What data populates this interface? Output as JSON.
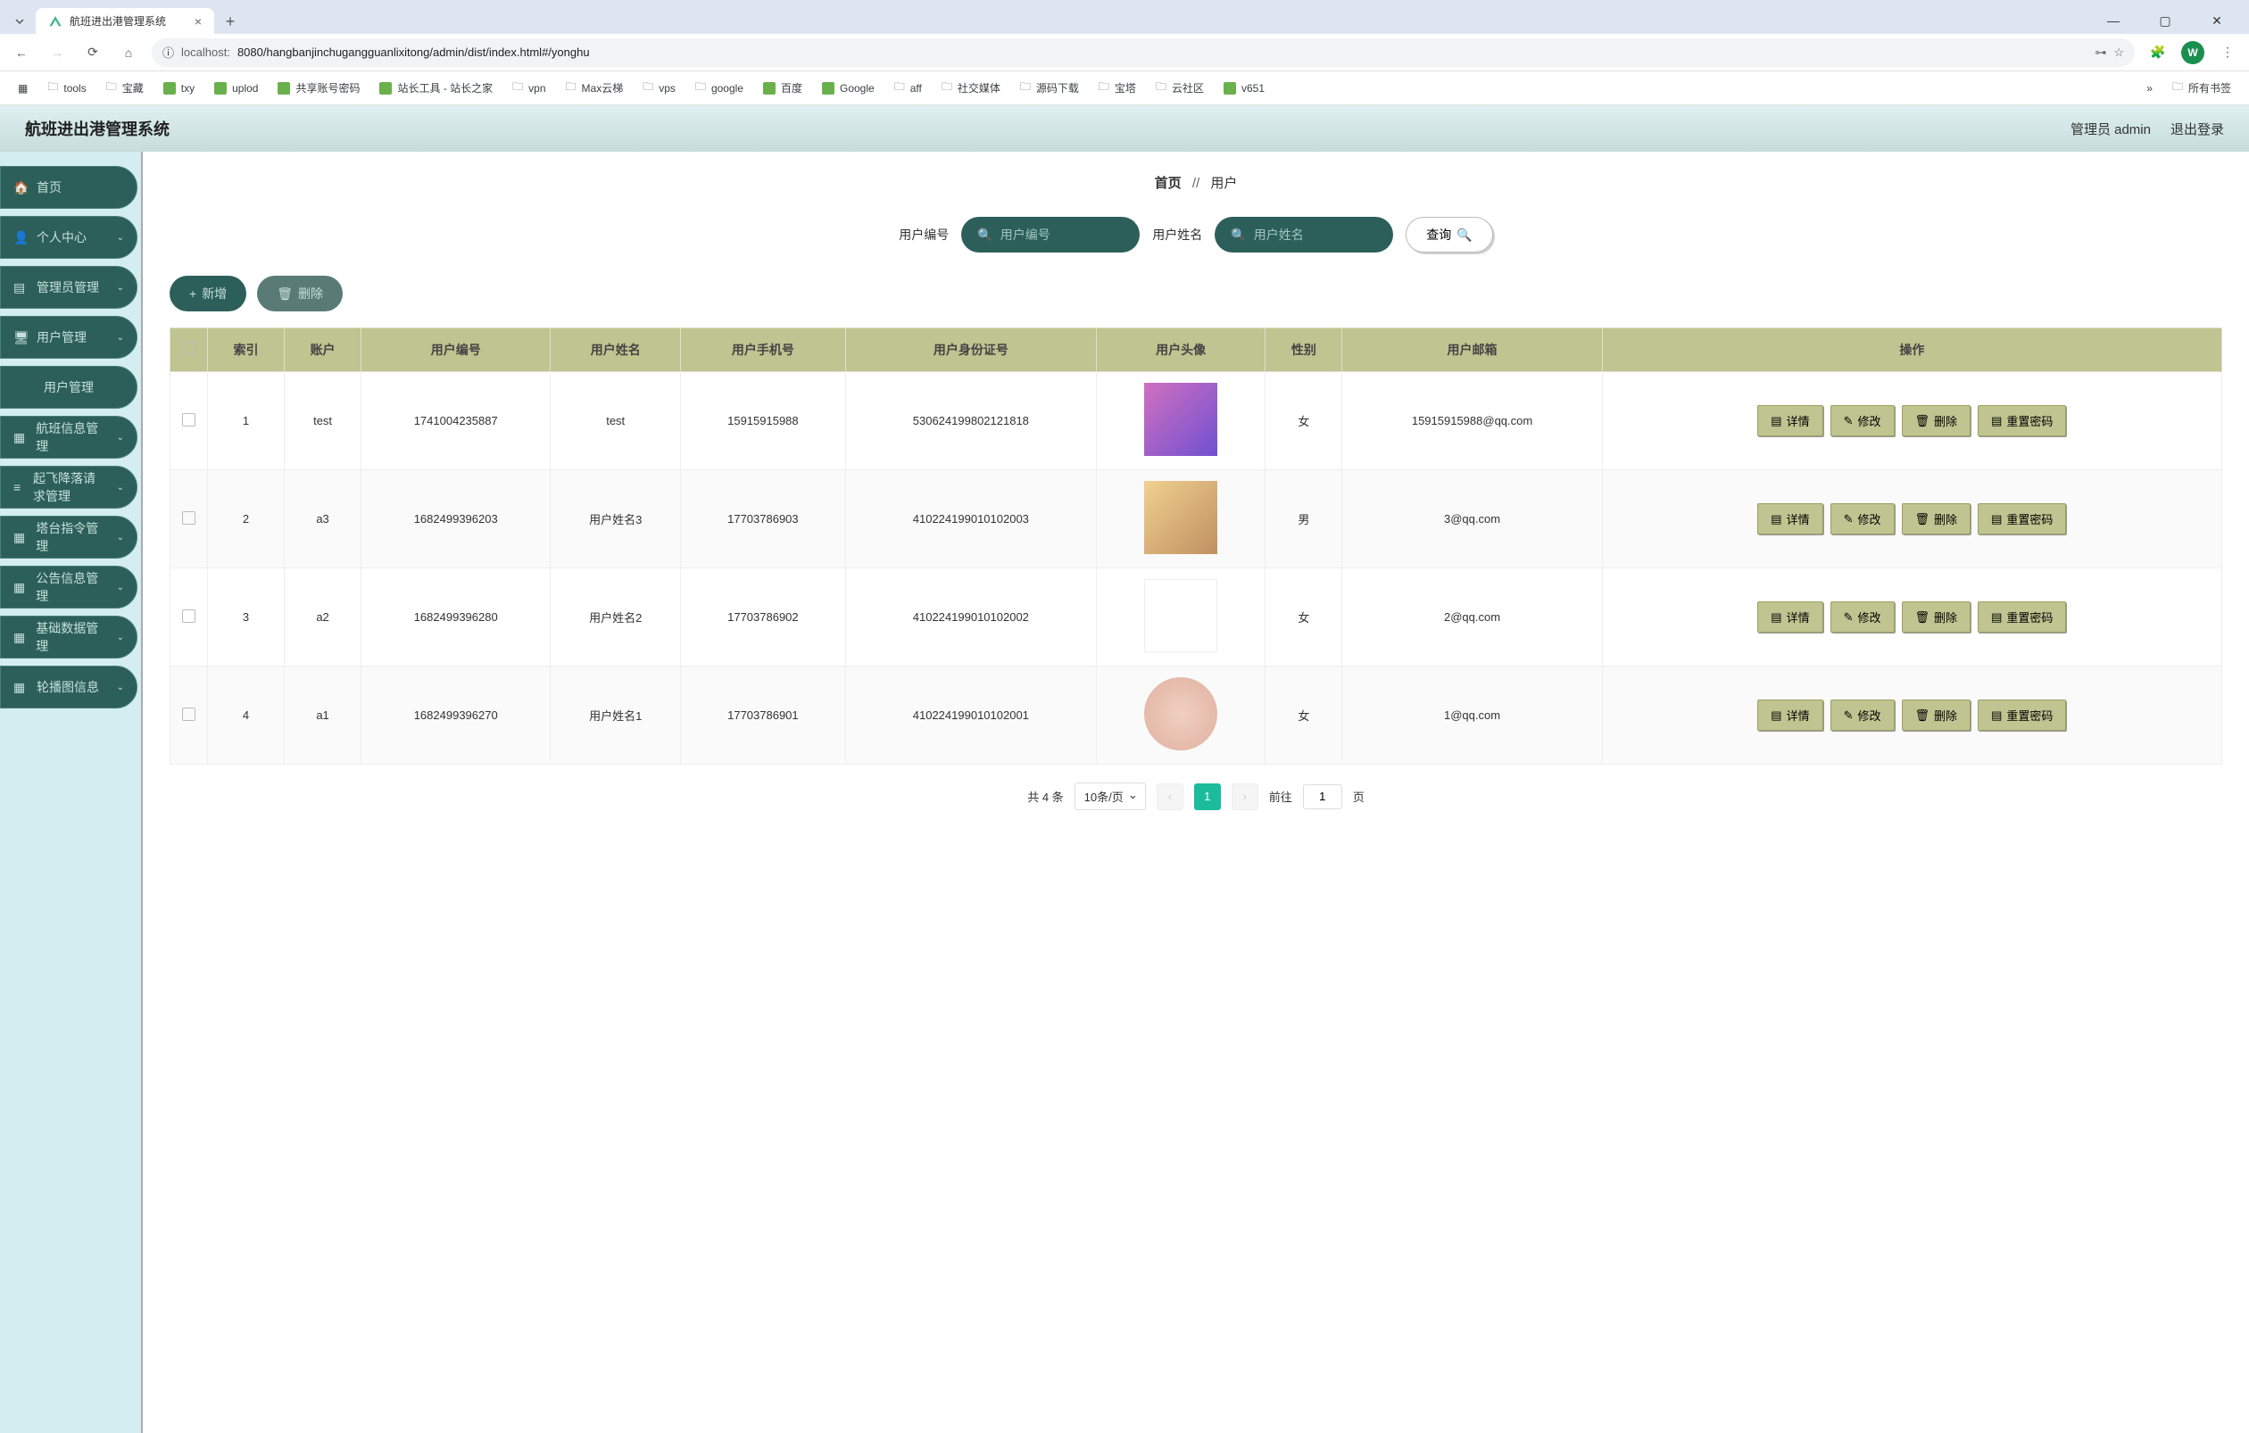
{
  "browser": {
    "tab_title": "航班进出港管理系统",
    "url_scheme_host": "localhost:",
    "url_rest": "8080/hangbanjinchugangguanlixitong/admin/dist/index.html#/yonghu",
    "profile_initial": "W"
  },
  "bookmarks": [
    {
      "label": "tools",
      "type": "folder"
    },
    {
      "label": "宝藏",
      "type": "folder"
    },
    {
      "label": "txy",
      "type": "link"
    },
    {
      "label": "uplod",
      "type": "link"
    },
    {
      "label": "共享账号密码",
      "type": "link"
    },
    {
      "label": "站长工具 - 站长之家",
      "type": "link"
    },
    {
      "label": "vpn",
      "type": "folder"
    },
    {
      "label": "Max云梯",
      "type": "folder"
    },
    {
      "label": "vps",
      "type": "folder"
    },
    {
      "label": "google",
      "type": "folder"
    },
    {
      "label": "百度",
      "type": "link"
    },
    {
      "label": "Google",
      "type": "link"
    },
    {
      "label": "aff",
      "type": "folder"
    },
    {
      "label": "社交媒体",
      "type": "folder"
    },
    {
      "label": "源码下载",
      "type": "folder"
    },
    {
      "label": "宝塔",
      "type": "folder"
    },
    {
      "label": "云社区",
      "type": "folder"
    },
    {
      "label": "v651",
      "type": "link"
    },
    {
      "label": "所有书签",
      "type": "folder"
    }
  ],
  "header": {
    "title": "航班进出港管理系统",
    "admin_label": "管理员 admin",
    "logout_label": "退出登录"
  },
  "sidebar": [
    {
      "label": "首页",
      "icon": "home",
      "expandable": false
    },
    {
      "label": "个人中心",
      "icon": "user",
      "expandable": true
    },
    {
      "label": "管理员管理",
      "icon": "admin",
      "expandable": true
    },
    {
      "label": "用户管理",
      "icon": "monitor",
      "expandable": true
    },
    {
      "label": "用户管理",
      "icon": "",
      "expandable": false,
      "submenu": true
    },
    {
      "label": "航班信息管理",
      "icon": "grid",
      "expandable": true
    },
    {
      "label": "起飞降落请求管理",
      "icon": "list",
      "expandable": true
    },
    {
      "label": "塔台指令管理",
      "icon": "grid",
      "expandable": true
    },
    {
      "label": "公告信息管理",
      "icon": "grid",
      "expandable": true
    },
    {
      "label": "基础数据管理",
      "icon": "grid",
      "expandable": true
    },
    {
      "label": "轮播图信息",
      "icon": "grid",
      "expandable": true
    }
  ],
  "breadcrumb": {
    "home": "首页",
    "sep": "//",
    "current": "用户"
  },
  "search": {
    "field1_label": "用户编号",
    "field1_placeholder": "用户编号",
    "field2_label": "用户姓名",
    "field2_placeholder": "用户姓名",
    "query_btn": "查询"
  },
  "actions": {
    "add": "新增",
    "delete": "删除"
  },
  "table": {
    "headers": [
      "",
      "索引",
      "账户",
      "用户编号",
      "用户姓名",
      "用户手机号",
      "用户身份证号",
      "用户头像",
      "性别",
      "用户邮箱",
      "操作"
    ],
    "rows": [
      {
        "idx": "1",
        "account": "test",
        "user_no": "1741004235887",
        "name": "test",
        "phone": "15915915988",
        "idcard": "530624199802121818",
        "avatar": "p1",
        "gender": "女",
        "email": "15915915988@qq.com"
      },
      {
        "idx": "2",
        "account": "a3",
        "user_no": "1682499396203",
        "name": "用户姓名3",
        "phone": "17703786903",
        "idcard": "410224199010102003",
        "avatar": "p2",
        "gender": "男",
        "email": "3@qq.com"
      },
      {
        "idx": "3",
        "account": "a2",
        "user_no": "1682499396280",
        "name": "用户姓名2",
        "phone": "17703786902",
        "idcard": "410224199010102002",
        "avatar": "p3",
        "gender": "女",
        "email": "2@qq.com"
      },
      {
        "idx": "4",
        "account": "a1",
        "user_no": "1682499396270",
        "name": "用户姓名1",
        "phone": "17703786901",
        "idcard": "410224199010102001",
        "avatar": "p4",
        "gender": "女",
        "email": "1@qq.com"
      }
    ],
    "ops": {
      "detail": "详情",
      "edit": "修改",
      "delete": "删除",
      "reset_pwd": "重置密码"
    }
  },
  "pagination": {
    "total_text": "共 4 条",
    "page_size": "10条/页",
    "current_page": "1",
    "jump_prefix": "前往",
    "jump_value": "1",
    "jump_suffix": "页"
  }
}
